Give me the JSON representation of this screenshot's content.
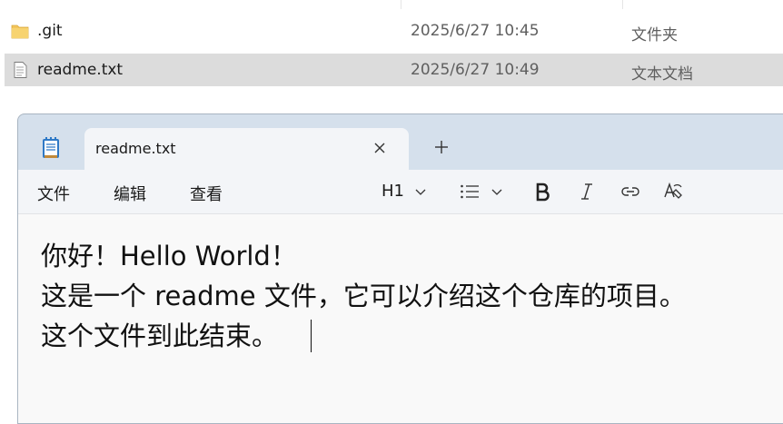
{
  "explorer": {
    "files": [
      {
        "name": ".git",
        "date": "2025/6/27 10:45",
        "type": "文件夹",
        "icon": "folder-icon",
        "selected": false
      },
      {
        "name": "readme.txt",
        "date": "2025/6/27 10:49",
        "type": "文本文档",
        "icon": "text-file-icon",
        "selected": true
      }
    ]
  },
  "notepad": {
    "tab": {
      "title": "readme.txt"
    },
    "menu": {
      "file": "文件",
      "edit": "编辑",
      "view": "查看"
    },
    "toolbar": {
      "heading": "H1"
    },
    "content": {
      "lines": [
        "你好！Hello World！",
        "这是一个 readme 文件，它可以介绍这个仓库的项目。",
        "这个文件到此结束。"
      ]
    }
  },
  "colors": {
    "titlebar": "#d5e0ec",
    "tab": "#f3f5f8",
    "editor": "#f9f9f9",
    "selected_row": "#dcdcdc",
    "folder": "#f3c55b"
  }
}
